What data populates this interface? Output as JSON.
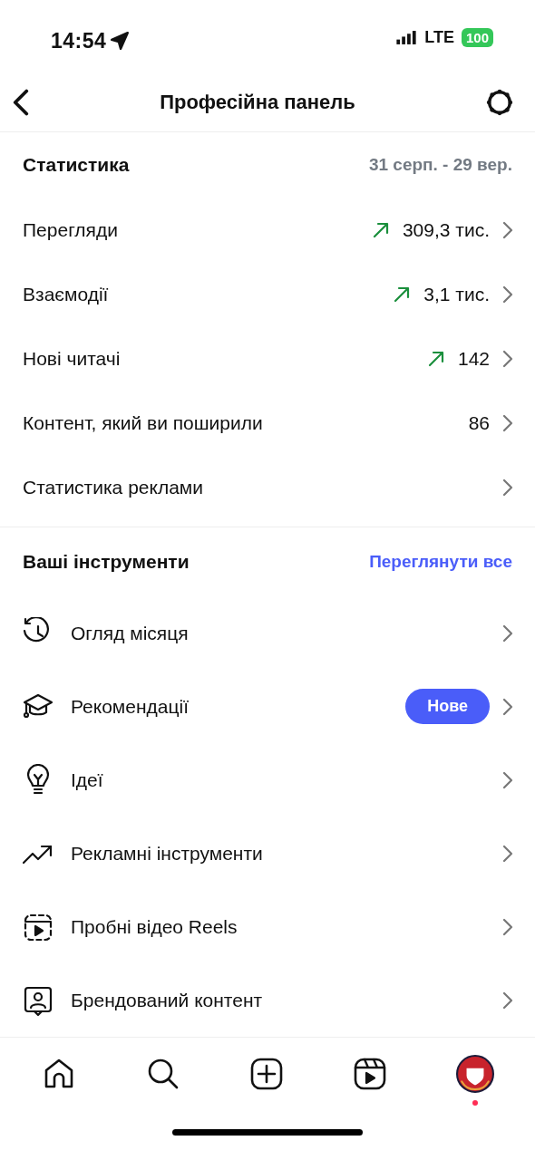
{
  "status_bar": {
    "time": "14:54",
    "network": "LTE",
    "battery": "100"
  },
  "header": {
    "title": "Професійна панель"
  },
  "statistics": {
    "title": "Статистика",
    "period": "31 серп. - 29 вер.",
    "rows": [
      {
        "label": "Перегляди",
        "value": "309,3 тис.",
        "trend_up": true
      },
      {
        "label": "Взаємодії",
        "value": "3,1 тис.",
        "trend_up": true
      },
      {
        "label": "Нові читачі",
        "value": "142",
        "trend_up": true
      },
      {
        "label": "Контент, який ви поширили",
        "value": "86",
        "trend_up": false
      },
      {
        "label": "Статистика реклами",
        "trend_up": false
      }
    ]
  },
  "tools": {
    "title": "Ваші інструменти",
    "link": "Переглянути все",
    "items": [
      {
        "label": "Огляд місяця"
      },
      {
        "label": "Рекомендації",
        "badge": "Нове"
      },
      {
        "label": "Ідеї"
      },
      {
        "label": "Рекламні інструменти"
      },
      {
        "label": "Пробні відео Reels"
      },
      {
        "label": "Брендований контент"
      }
    ]
  },
  "bottom_nav": {
    "notification": true
  }
}
